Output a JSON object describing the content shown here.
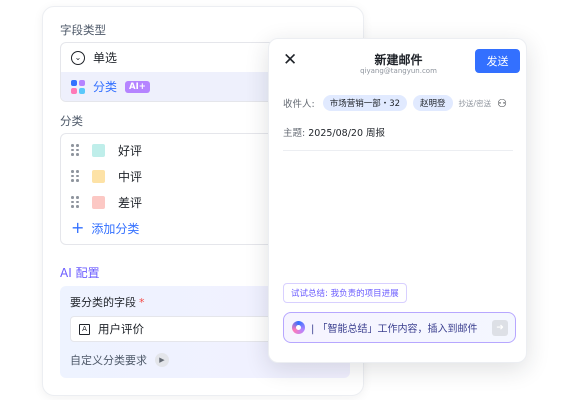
{
  "field_panel": {
    "field_type_label": "字段类型",
    "types": [
      {
        "label": "单选",
        "icon": "circle-chevron-icon"
      },
      {
        "label": "分类",
        "icon": "colorful-grid-icon",
        "badge": "AI+"
      }
    ],
    "category_label": "分类",
    "categories": [
      {
        "label": "好评",
        "color": "#bfeeea"
      },
      {
        "label": "中评",
        "color": "#fde2a6"
      },
      {
        "label": "差评",
        "color": "#fcc8c4"
      }
    ],
    "add_category": "添加分类",
    "ai_config_title": "AI 配置",
    "ai_field_label": "要分类的字段",
    "required_mark": "*",
    "ai_field_value": "用户评价",
    "ai_field_icon_letter": "A",
    "custom_requirement": "自定义分类要求"
  },
  "mail_panel": {
    "title": "新建邮件",
    "from": "qiyang@tangyun.com",
    "send": "发送",
    "recipient_label": "收件人:",
    "recipients": [
      "市场营销一部・32",
      "赵明登"
    ],
    "cc_label": "抄送/密送",
    "subject_label": "主题:",
    "subject_value": "2025/08/20 周报",
    "suggestion": "试试总结: 我负责的项目进展",
    "ai_prompt": "| 「智能总结」工作内容，插入到邮件"
  },
  "colors": {
    "accent": "#3370ff",
    "ai_purple": "#6b5cff",
    "ai_badge": "#b584ff"
  }
}
